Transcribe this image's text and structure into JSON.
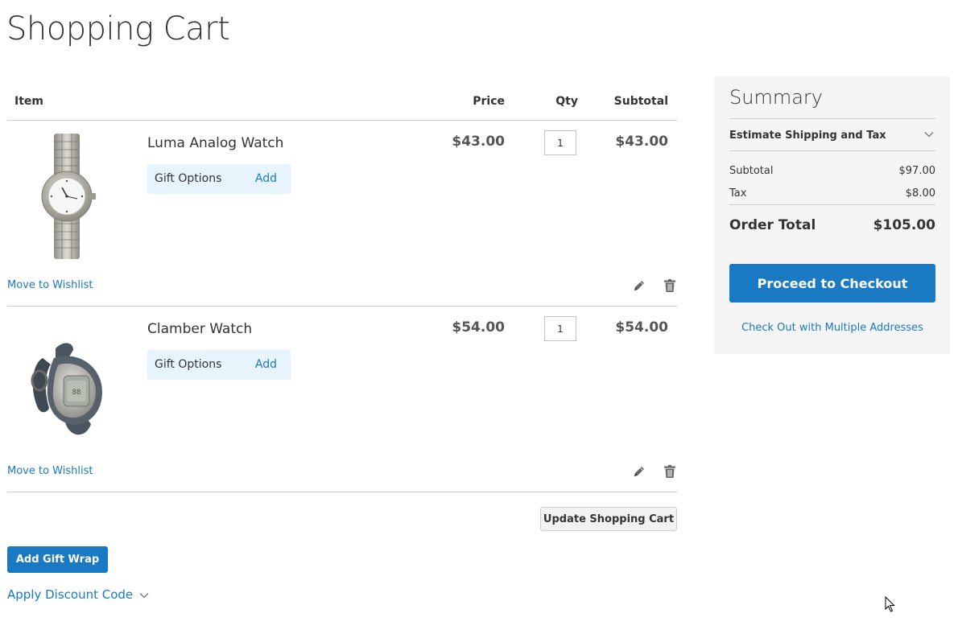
{
  "page": {
    "title": "Shopping Cart"
  },
  "cart": {
    "headers": {
      "item": "Item",
      "price": "Price",
      "qty": "Qty",
      "subtotal": "Subtotal"
    },
    "items": [
      {
        "name": "Luma Analog Watch",
        "price": "$43.00",
        "qty": "1",
        "subtotal": "$43.00",
        "gift_label": "Gift Options",
        "gift_action": "Add",
        "wishlist": "Move to Wishlist"
      },
      {
        "name": "Clamber Watch",
        "price": "$54.00",
        "qty": "1",
        "subtotal": "$54.00",
        "gift_label": "Gift Options",
        "gift_action": "Add",
        "wishlist": "Move to Wishlist"
      }
    ],
    "update_button": "Update Shopping Cart",
    "gift_wrap_button": "Add Gift Wrap",
    "discount_label": "Apply Discount Code"
  },
  "summary": {
    "title": "Summary",
    "estimate_label": "Estimate Shipping and Tax",
    "subtotal_label": "Subtotal",
    "subtotal_value": "$97.00",
    "tax_label": "Tax",
    "tax_value": "$8.00",
    "total_label": "Order Total",
    "total_value": "$105.00",
    "checkout_button": "Proceed to Checkout",
    "multi_address_link": "Check Out with Multiple Addresses"
  },
  "icons": {
    "edit": "pencil-icon",
    "delete": "trash-icon",
    "expand": "chevron-down-icon",
    "cursor": "mouse-pointer-icon"
  },
  "colors": {
    "accent": "#1979c3",
    "summary_background": "#f5f5f5",
    "gift_background": "#e8f4fc",
    "text": "#333333"
  }
}
